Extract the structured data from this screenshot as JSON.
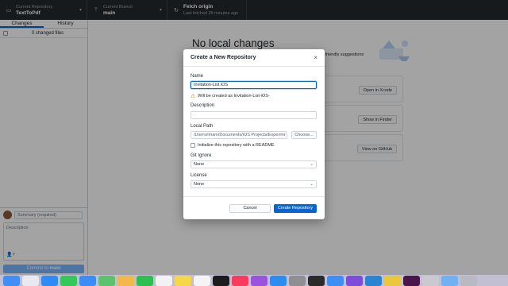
{
  "toolbar": {
    "repo": {
      "small": "Current Repository",
      "big": "TextToPdf"
    },
    "branch": {
      "small": "Current Branch",
      "big": "main"
    },
    "fetch": {
      "big": "Fetch origin",
      "small": "Last fetched 28 minutes ago"
    }
  },
  "sidebar": {
    "tabs": [
      {
        "label": "Changes"
      },
      {
        "label": "History"
      }
    ],
    "changed_files": "0 changed files",
    "summary_placeholder": "Summary (required)",
    "description_placeholder": "Description",
    "commit_prefix": "Commit to ",
    "commit_branch": "main"
  },
  "main": {
    "title": "No local changes",
    "suggestions_text": "ne friendly suggestions",
    "cards": [
      {
        "button": "Open in Xcode"
      },
      {
        "button": "Show in Finder"
      },
      {
        "button": "View on GitHub"
      }
    ]
  },
  "dialog": {
    "title": "Create a New Repository",
    "close": "×",
    "name_label": "Name",
    "name_value": "Invitation-List iOS",
    "warning": "Will be created as Invitation-List-iOS-",
    "description_label": "Description",
    "description_value": "",
    "local_path_label": "Local Path",
    "local_path_value": "/Users/imam/Documents/iOS Projects/Experimr",
    "choose_button": "Choose...",
    "readme_label": "Initialize this repository with a README",
    "gitignore_label": "Git Ignore",
    "gitignore_value": "None",
    "license_label": "License",
    "license_value": "None",
    "cancel_button": "Cancel",
    "create_button": "Create Repository"
  },
  "dock": {
    "apps": [
      {
        "name": "finder-icon",
        "color": "#3f8ff6"
      },
      {
        "name": "launchpad-icon",
        "color": "#e9e9ef"
      },
      {
        "name": "safari-icon",
        "color": "#2f8cf5"
      },
      {
        "name": "messages-icon",
        "color": "#34c759"
      },
      {
        "name": "mail-icon",
        "color": "#3b8df5"
      },
      {
        "name": "maps-icon",
        "color": "#5bc36b"
      },
      {
        "name": "photos-icon",
        "color": "#f2b94a"
      },
      {
        "name": "facetime-icon",
        "color": "#2fbf50"
      },
      {
        "name": "calendar-icon",
        "color": "#f2f2f2"
      },
      {
        "name": "notes-icon",
        "color": "#f7d74a"
      },
      {
        "name": "reminders-icon",
        "color": "#f4f4f4"
      },
      {
        "name": "tv-icon",
        "color": "#1c1c1e"
      },
      {
        "name": "music-icon",
        "color": "#fa3c5c"
      },
      {
        "name": "podcasts-icon",
        "color": "#9b52e0"
      },
      {
        "name": "appstore-icon",
        "color": "#2d8cf0"
      },
      {
        "name": "settings-icon",
        "color": "#8e8e93"
      },
      {
        "name": "terminal-icon",
        "color": "#2b2b2b"
      },
      {
        "name": "xcode-icon",
        "color": "#3e8ff5"
      },
      {
        "name": "github-desktop-icon",
        "color": "#7d4cdb"
      },
      {
        "name": "vscode-icon",
        "color": "#2a84d2"
      },
      {
        "name": "chrome-icon",
        "color": "#e9c83b"
      },
      {
        "name": "slack-icon",
        "color": "#4a154b"
      },
      {
        "name": "preview-icon",
        "color": "#c9c9cf"
      },
      {
        "name": "folder-icon",
        "color": "#6fb1f2"
      },
      {
        "name": "trash-icon",
        "color": "#b9b9c4"
      }
    ]
  }
}
